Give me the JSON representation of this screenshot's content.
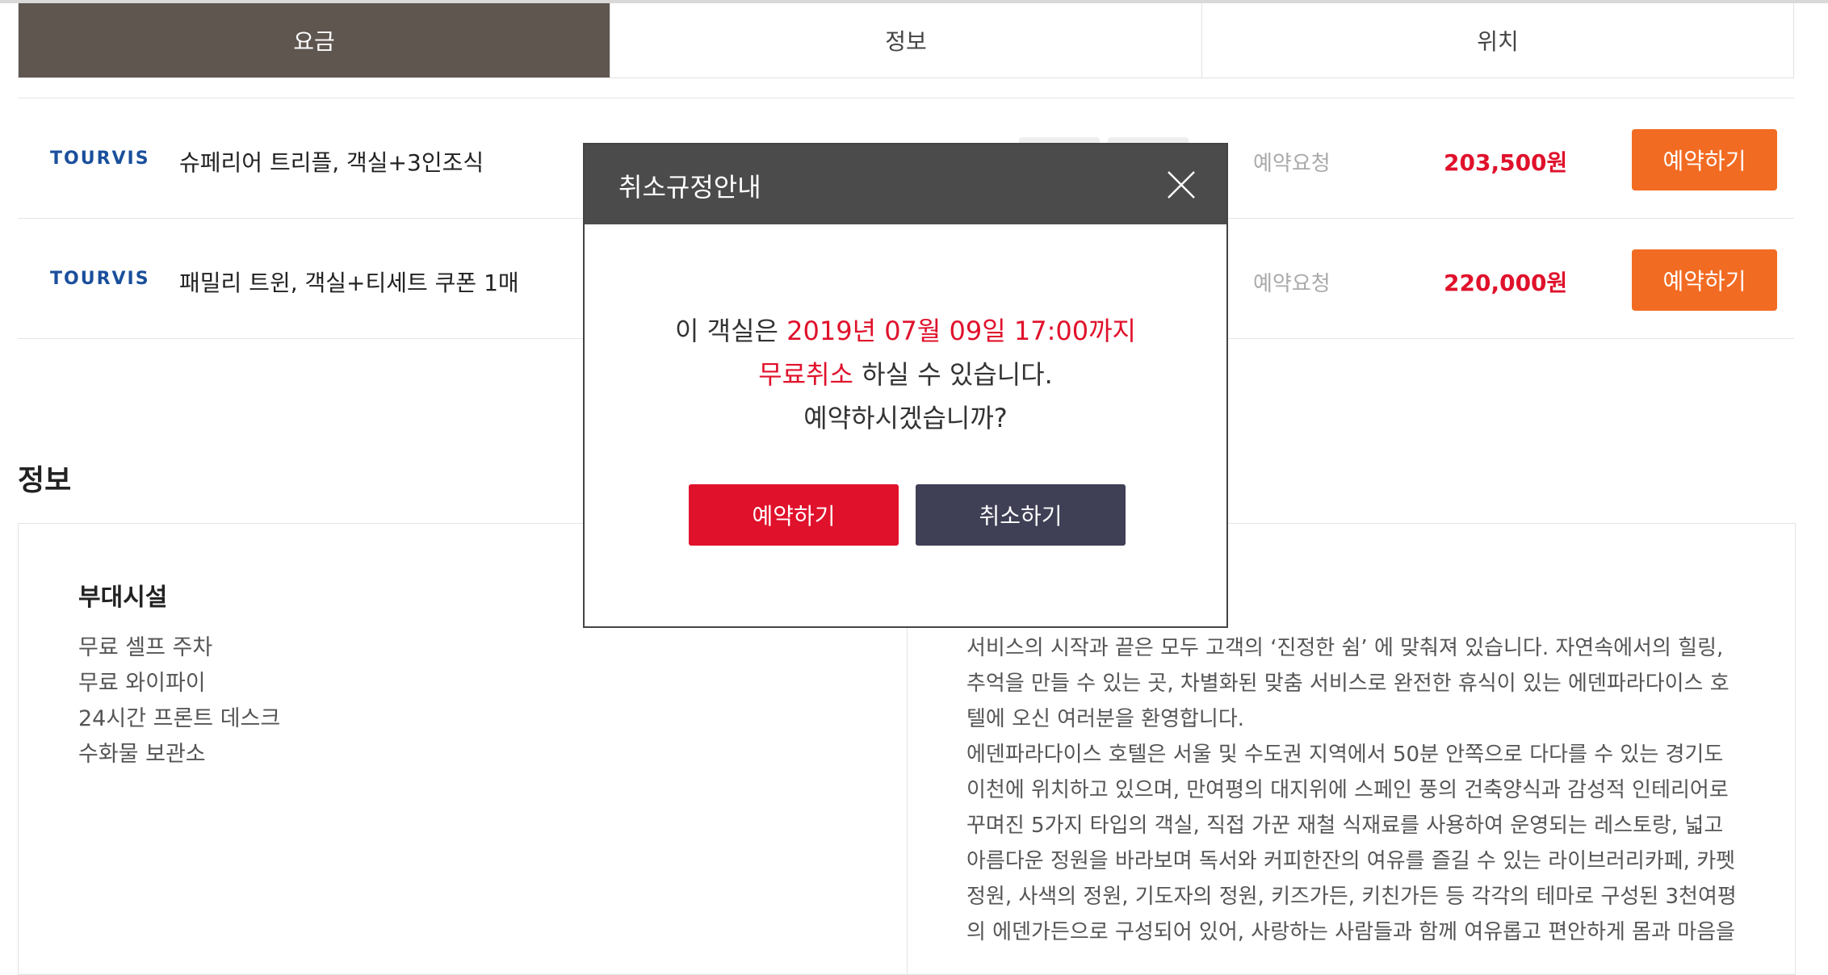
{
  "tabs": [
    {
      "label": "요금"
    },
    {
      "label": "정보"
    },
    {
      "label": "위치"
    }
  ],
  "rooms": [
    {
      "provider": "TOURVIS",
      "name": "슈페리어 트리플, 객실+3인조식",
      "status": "예약요청",
      "price": "203,500원",
      "book_label": "예약하기"
    },
    {
      "provider": "TOURVIS",
      "name": "패밀리 트윈, 객실+티세트 쿠폰 1매",
      "status": "예약요청",
      "price": "220,000원",
      "book_label": "예약하기"
    }
  ],
  "info": {
    "section_title": "정보",
    "facilities_title": "부대시설",
    "facilities": [
      "무료 셀프 주차",
      "무료 와이파이",
      "24시간 프론트 데스크",
      "수화물 보관소"
    ],
    "description_lines": [
      "서비스의 시작과 끝은 모두 고객의 ‘진정한 쉼’ 에 맞춰져 있습니다. 자연속에서의 힐링,",
      "추억을 만들 수 있는 곳, 차별화된 맞춤 서비스로 완전한 휴식이 있는 에덴파라다이스 호",
      "텔에 오신 여러분을 환영합니다.",
      "에덴파라다이스 호텔은 서울 및 수도권 지역에서 50분 안쪽으로 다다를 수 있는 경기도",
      "이천에 위치하고 있으며, 만여평의 대지위에 스페인 풍의 건축양식과 감성적 인테리어로",
      "꾸며진 5가지 타입의 객실, 직접 가꾼 재철 식재료를 사용하여 운영되는 레스토랑, 넓고",
      "아름다운 정원을 바라보며 독서와 커피한잔의 여유를 즐길 수 있는 라이브러리카페, 카펫",
      "정원, 사색의 정원, 기도자의 정원, 키즈가든, 키친가든 등 각각의 테마로 구성된 3천여평",
      "의 에덴가든으로 구성되어 있어, 사랑하는 사람들과 함께 여유롭고 편안하게 몸과 마음을"
    ]
  },
  "modal": {
    "title": "취소규정안내",
    "line1_prefix": "이 객실은 ",
    "line1_date": "2019년 07월 09일 17:00까지",
    "line2_highlight": "무료취소",
    "line2_rest": " 하실 수 있습니다.",
    "line3": "예약하시겠습니까?",
    "confirm_label": "예약하기",
    "cancel_label": "취소하기"
  },
  "colors": {
    "tab_active": "#5f5650",
    "accent_orange": "#f26b22",
    "price_red": "#e0112b",
    "modal_header": "#4b4b4b",
    "cancel_button": "#3f3f55"
  }
}
